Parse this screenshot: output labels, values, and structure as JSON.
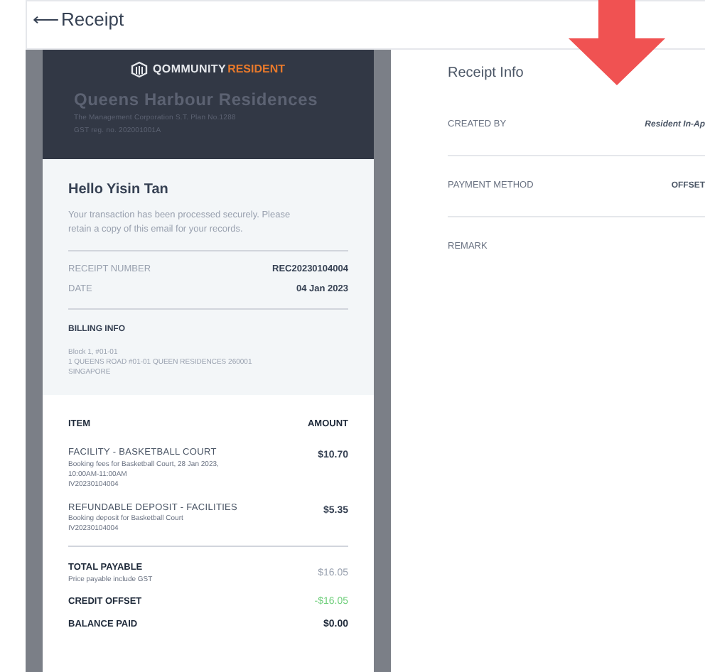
{
  "header": {
    "back_icon": "⟵",
    "title": "Receipt"
  },
  "receipt": {
    "logo": {
      "brand": "QOMMUNITY",
      "suffix": "RESIDENT"
    },
    "estate": "Queens Harbour Residences",
    "lines": [
      "The Management Corporation S.T. Plan No.1288",
      "GST reg. no. 202001001A"
    ],
    "greeting": "Hello Yisin Tan",
    "message": "Your transaction has been processed securely. Please retain a copy of this email for your records.",
    "fields": [
      {
        "label": "RECEIPT NUMBER",
        "value": "REC20230104004"
      },
      {
        "label": "DATE",
        "value": "04 Jan 2023"
      }
    ],
    "billing": {
      "title": "BILLING INFO",
      "lines": [
        "Block 1, #01-01",
        "1 QUEENS ROAD #01-01 QUEEN RESIDENCES 260001",
        "SINGAPORE"
      ]
    },
    "columns": [
      "ITEM",
      "AMOUNT"
    ],
    "items": [
      {
        "name": "FACILITY - BASKETBALL COURT",
        "details": [
          "Booking fees for Basketball Court, 28 Jan 2023, 10:00AM-11:00AM",
          "IV20230104004"
        ],
        "amount": "$10.70"
      },
      {
        "name": "REFUNDABLE DEPOSIT - FACILITIES",
        "details": [
          "Booking deposit for Basketball Court",
          "IV20230104004"
        ],
        "amount": "$5.35"
      }
    ],
    "totals": [
      {
        "label": "TOTAL PAYABLE",
        "note": "Price payable include GST",
        "value": "$16.05",
        "kind": "muted"
      },
      {
        "label": "CREDIT OFFSET",
        "value": "-$16.05",
        "kind": "credit"
      },
      {
        "label": "BALANCE PAID",
        "value": "$0.00",
        "kind": "strong"
      }
    ]
  },
  "info": {
    "title": "Receipt Info",
    "rows": [
      {
        "label": "CREATED BY",
        "value": "Resident In-Ap",
        "kind": "italic"
      },
      {
        "label": "PAYMENT METHOD",
        "value": "OFFSET",
        "kind": "bold"
      },
      {
        "label": "REMARK"
      }
    ]
  }
}
